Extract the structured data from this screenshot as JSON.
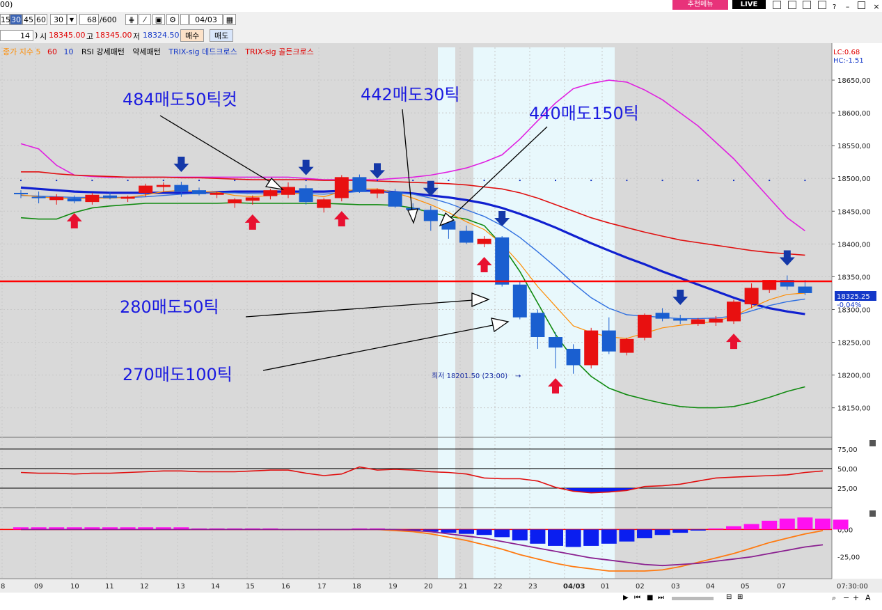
{
  "topbar": {
    "left_fragment": "00)",
    "promo_menu": "추천메뉴",
    "live_badge": "LIVE",
    "window_icons": [
      "layout-icon",
      "tile-icon",
      "link-icon",
      "lock-icon",
      "help-icon",
      "minimize-icon",
      "maximize-icon",
      "close-icon"
    ]
  },
  "toolbar": {
    "intervals": [
      "15",
      "30",
      "45",
      "60"
    ],
    "selected_interval": "30",
    "interval_input": "30",
    "count": "68",
    "count_total": "/600",
    "date": "04/03"
  },
  "pricebar": {
    "period": "14",
    "open_label": "시",
    "open": "18345.00",
    "high_label": "고",
    "high": "18345.00",
    "low_label": "저",
    "low": "18324.50",
    "buy_label": "매수",
    "sell_label": "매도"
  },
  "bottom_nav": {
    "icons": [
      "play-icon",
      "rewind-icon",
      "stop-icon",
      "fast-forward-icon"
    ]
  },
  "chart_data": [
    {
      "type": "candlestick",
      "legend": [
        {
          "name": "종가 지수 5",
          "color": "#ff8c00"
        },
        {
          "name": "60",
          "color": "#e00000"
        },
        {
          "name": "10",
          "color": "#1438c8"
        },
        {
          "name": "RSI 강세패턴",
          "color": "#000000"
        },
        {
          "name": "약세패턴",
          "color": "#000000"
        },
        {
          "name": "TRIX-sig 데드크로스",
          "color": "#1438c8"
        },
        {
          "name": "TRIX-sig 골든크로스",
          "color": "#e00000"
        }
      ],
      "corner_labels": {
        "lc": "LC:0.68",
        "hc": "HC:-1.51"
      },
      "x_labels": [
        "8",
        "09",
        "10",
        "11",
        "12",
        "13",
        "14",
        "15",
        "16",
        "17",
        "18",
        "19",
        "20",
        "21",
        "22",
        "23",
        "04/03",
        "01",
        "02",
        "03",
        "04",
        "05",
        "07"
      ],
      "y_ticks": [
        18150,
        18200,
        18250,
        18300,
        18350,
        18400,
        18450,
        18500,
        18550,
        18600,
        18650
      ],
      "y_tick_labels": [
        "18150,00",
        "18200,00",
        "18250,00",
        "18300,00",
        "18350,00",
        "18400,00",
        "18450,00",
        "18500,00",
        "18550,00",
        "18600,00",
        "18650,00"
      ],
      "ylim": [
        18105,
        18700
      ],
      "bottom_right_time": "07:30:00",
      "current_price": {
        "value": 18325.25,
        "label": "18325.25",
        "change": "-0.04%"
      },
      "reference_line": 18343,
      "low_annotation": "최저 18201.50 (23:00)",
      "candles": [
        {
          "o": 18478,
          "h": 18482,
          "l": 18470,
          "c": 18476
        },
        {
          "o": 18472,
          "h": 18480,
          "l": 18462,
          "c": 18470
        },
        {
          "o": 18467,
          "h": 18476,
          "l": 18460,
          "c": 18472
        },
        {
          "o": 18470,
          "h": 18474,
          "l": 18462,
          "c": 18465
        },
        {
          "o": 18464,
          "h": 18478,
          "l": 18460,
          "c": 18475
        },
        {
          "o": 18474,
          "h": 18480,
          "l": 18468,
          "c": 18470
        },
        {
          "o": 18469,
          "h": 18474,
          "l": 18464,
          "c": 18472
        },
        {
          "o": 18478,
          "h": 18492,
          "l": 18472,
          "c": 18489
        },
        {
          "o": 18487,
          "h": 18494,
          "l": 18480,
          "c": 18490
        },
        {
          "o": 18490,
          "h": 18495,
          "l": 18472,
          "c": 18480
        },
        {
          "o": 18482,
          "h": 18486,
          "l": 18474,
          "c": 18476
        },
        {
          "o": 18475,
          "h": 18480,
          "l": 18470,
          "c": 18478
        },
        {
          "o": 18462,
          "h": 18470,
          "l": 18455,
          "c": 18468
        },
        {
          "o": 18466,
          "h": 18474,
          "l": 18460,
          "c": 18471
        },
        {
          "o": 18473,
          "h": 18484,
          "l": 18468,
          "c": 18482
        },
        {
          "o": 18475,
          "h": 18494,
          "l": 18470,
          "c": 18487
        },
        {
          "o": 18485,
          "h": 18490,
          "l": 18460,
          "c": 18464
        },
        {
          "o": 18455,
          "h": 18470,
          "l": 18448,
          "c": 18468
        },
        {
          "o": 18470,
          "h": 18505,
          "l": 18465,
          "c": 18502
        },
        {
          "o": 18502,
          "h": 18506,
          "l": 18478,
          "c": 18480
        },
        {
          "o": 18477,
          "h": 18485,
          "l": 18470,
          "c": 18483
        },
        {
          "o": 18480,
          "h": 18484,
          "l": 18455,
          "c": 18457
        },
        {
          "o": 18455,
          "h": 18462,
          "l": 18448,
          "c": 18452
        },
        {
          "o": 18452,
          "h": 18458,
          "l": 18420,
          "c": 18435
        },
        {
          "o": 18435,
          "h": 18440,
          "l": 18408,
          "c": 18422
        },
        {
          "o": 18420,
          "h": 18428,
          "l": 18400,
          "c": 18402
        },
        {
          "o": 18400,
          "h": 18412,
          "l": 18395,
          "c": 18408
        },
        {
          "o": 18410,
          "h": 18412,
          "l": 18335,
          "c": 18338
        },
        {
          "o": 18338,
          "h": 18342,
          "l": 18285,
          "c": 18288
        },
        {
          "o": 18295,
          "h": 18300,
          "l": 18240,
          "c": 18258
        },
        {
          "o": 18258,
          "h": 18265,
          "l": 18210,
          "c": 18242
        },
        {
          "o": 18240,
          "h": 18247,
          "l": 18202,
          "c": 18215
        },
        {
          "o": 18215,
          "h": 18272,
          "l": 18210,
          "c": 18268
        },
        {
          "o": 18268,
          "h": 18288,
          "l": 18232,
          "c": 18236
        },
        {
          "o": 18234,
          "h": 18257,
          "l": 18230,
          "c": 18255
        },
        {
          "o": 18257,
          "h": 18294,
          "l": 18253,
          "c": 18292
        },
        {
          "o": 18295,
          "h": 18302,
          "l": 18282,
          "c": 18286
        },
        {
          "o": 18286,
          "h": 18292,
          "l": 18278,
          "c": 18283
        },
        {
          "o": 18278,
          "h": 18287,
          "l": 18275,
          "c": 18285
        },
        {
          "o": 18280,
          "h": 18290,
          "l": 18275,
          "c": 18286
        },
        {
          "o": 18282,
          "h": 18315,
          "l": 18278,
          "c": 18312
        },
        {
          "o": 18308,
          "h": 18340,
          "l": 18302,
          "c": 18333
        },
        {
          "o": 18330,
          "h": 18345,
          "l": 18325,
          "c": 18345
        },
        {
          "o": 18345,
          "h": 18352,
          "l": 18330,
          "c": 18335
        },
        {
          "o": 18335,
          "h": 18345,
          "l": 18322,
          "c": 18325
        }
      ],
      "ma5": [
        18475,
        18472,
        18470,
        18469,
        18470,
        18470,
        18471,
        18475,
        18480,
        18482,
        18480,
        18479,
        18474,
        18472,
        18474,
        18478,
        18476,
        18472,
        18480,
        18484,
        18484,
        18478,
        18470,
        18460,
        18448,
        18434,
        18422,
        18400,
        18370,
        18335,
        18305,
        18275,
        18265,
        18258,
        18256,
        18264,
        18272,
        18276,
        18279,
        18282,
        18290,
        18303,
        18315,
        18323,
        18325
      ],
      "ma10": [
        18474,
        18473,
        18472,
        18471,
        18471,
        18471,
        18471,
        18472,
        18474,
        18476,
        18477,
        18478,
        18478,
        18477,
        18476,
        18477,
        18477,
        18476,
        18478,
        18480,
        18481,
        18479,
        18476,
        18470,
        18462,
        18452,
        18442,
        18428,
        18410,
        18388,
        18365,
        18340,
        18318,
        18302,
        18292,
        18290,
        18288,
        18286,
        18286,
        18287,
        18290,
        18298,
        18306,
        18312,
        18316
      ],
      "ma60": [
        18486,
        18484,
        18482,
        18480,
        18479,
        18478,
        18478,
        18478,
        18478,
        18478,
        18478,
        18479,
        18480,
        18480,
        18480,
        18480,
        18480,
        18480,
        18481,
        18481,
        18481,
        18479,
        18477,
        18474,
        18471,
        18467,
        18462,
        18455,
        18446,
        18436,
        18425,
        18413,
        18401,
        18390,
        18379,
        18369,
        18358,
        18348,
        18338,
        18328,
        18318,
        18309,
        18302,
        18297,
        18293
      ],
      "bb_upper": [
        18553,
        18545,
        18520,
        18505,
        18503,
        18502,
        18502,
        18502,
        18502,
        18502,
        18502,
        18502,
        18502,
        18502,
        18502,
        18502,
        18500,
        18498,
        18498,
        18498,
        18498,
        18500,
        18502,
        18505,
        18510,
        18516,
        18525,
        18536,
        18560,
        18588,
        18615,
        18637,
        18645,
        18650,
        18647,
        18635,
        18620,
        18600,
        18580,
        18555,
        18530,
        18500,
        18470,
        18440,
        18420
      ],
      "bb_middle": [
        18510,
        18510,
        18507,
        18505,
        18504,
        18503,
        18502,
        18502,
        18502,
        18501,
        18501,
        18500,
        18499,
        18498,
        18498,
        18498,
        18498,
        18497,
        18497,
        18497,
        18496,
        18495,
        18494,
        18493,
        18492,
        18490,
        18487,
        18484,
        18478,
        18470,
        18460,
        18450,
        18440,
        18432,
        18425,
        18418,
        18412,
        18406,
        18402,
        18398,
        18394,
        18390,
        18387,
        18385,
        18383
      ],
      "bb_lower": [
        18440,
        18438,
        18438,
        18448,
        18455,
        18458,
        18460,
        18462,
        18462,
        18462,
        18462,
        18462,
        18463,
        18462,
        18462,
        18462,
        18462,
        18462,
        18461,
        18460,
        18460,
        18459,
        18455,
        18448,
        18442,
        18438,
        18428,
        18398,
        18358,
        18310,
        18262,
        18225,
        18198,
        18180,
        18170,
        18163,
        18157,
        18152,
        18150,
        18150,
        18152,
        18158,
        18166,
        18175,
        18182
      ],
      "dots_level": 18497,
      "annotations": [
        {
          "text": "484매도50틱컷"
        },
        {
          "text": "442매도30틱"
        },
        {
          "text": "440매도150틱"
        },
        {
          "text": "280매도50틱"
        },
        {
          "text": "270매도100틱"
        }
      ],
      "buy_signals": [
        3,
        13,
        18,
        26,
        30,
        40
      ],
      "sell_signals": [
        9,
        16,
        20,
        23,
        27,
        37,
        43
      ]
    },
    {
      "type": "line",
      "name": "RSI",
      "y_ticks": [
        25,
        50,
        75
      ],
      "y_tick_labels": [
        "25,00",
        "50,00",
        "75,00"
      ],
      "ylim": [
        0,
        90
      ],
      "values": [
        45,
        44,
        44,
        43,
        44,
        44,
        45,
        46,
        47,
        47,
        46,
        46,
        46,
        47,
        48,
        48,
        44,
        41,
        43,
        52,
        48,
        49,
        48,
        46,
        45,
        43,
        38,
        37,
        37,
        34,
        26,
        21,
        19,
        20,
        22,
        27,
        28,
        30,
        34,
        38,
        39,
        40,
        41,
        42,
        45,
        47
      ]
    },
    {
      "type": "bar",
      "name": "MACD",
      "y_ticks": [
        0,
        -25
      ],
      "y_tick_labels": [
        "0,00",
        "-25,00"
      ],
      "ylim": [
        -45,
        20
      ],
      "values": [
        2,
        2,
        2,
        2,
        2,
        2,
        2,
        2,
        2,
        2,
        1,
        1,
        1,
        1,
        1,
        0,
        0,
        0,
        0,
        1,
        1,
        0,
        -1,
        -2,
        -3,
        -4,
        -5,
        -7,
        -10,
        -13,
        -15,
        -16,
        -15,
        -13,
        -11,
        -8,
        -5,
        -3,
        -1,
        1,
        3,
        5,
        8,
        10,
        11,
        10,
        9
      ],
      "macd_line": [
        0,
        0,
        0,
        0,
        0,
        0,
        0,
        0,
        0,
        0,
        0,
        0,
        0,
        0,
        0,
        0,
        0,
        0,
        0,
        0,
        0,
        -1,
        -2,
        -4,
        -7,
        -10,
        -14,
        -18,
        -23,
        -27,
        -31,
        -34,
        -36,
        -38,
        -38,
        -38,
        -37,
        -34,
        -30,
        -26,
        -22,
        -17,
        -12,
        -8,
        -4,
        -1
      ],
      "signal_line": [
        0,
        0,
        0,
        0,
        0,
        0,
        0,
        0,
        0,
        0,
        0,
        0,
        0,
        0,
        0,
        0,
        0,
        0,
        0,
        0,
        0,
        0,
        -1,
        -2,
        -4,
        -6,
        -8,
        -11,
        -14,
        -17,
        -20,
        -23,
        -26,
        -28,
        -30,
        -32,
        -33,
        -32,
        -31,
        -29,
        -27,
        -25,
        -22,
        -19,
        -16,
        -14
      ]
    }
  ]
}
